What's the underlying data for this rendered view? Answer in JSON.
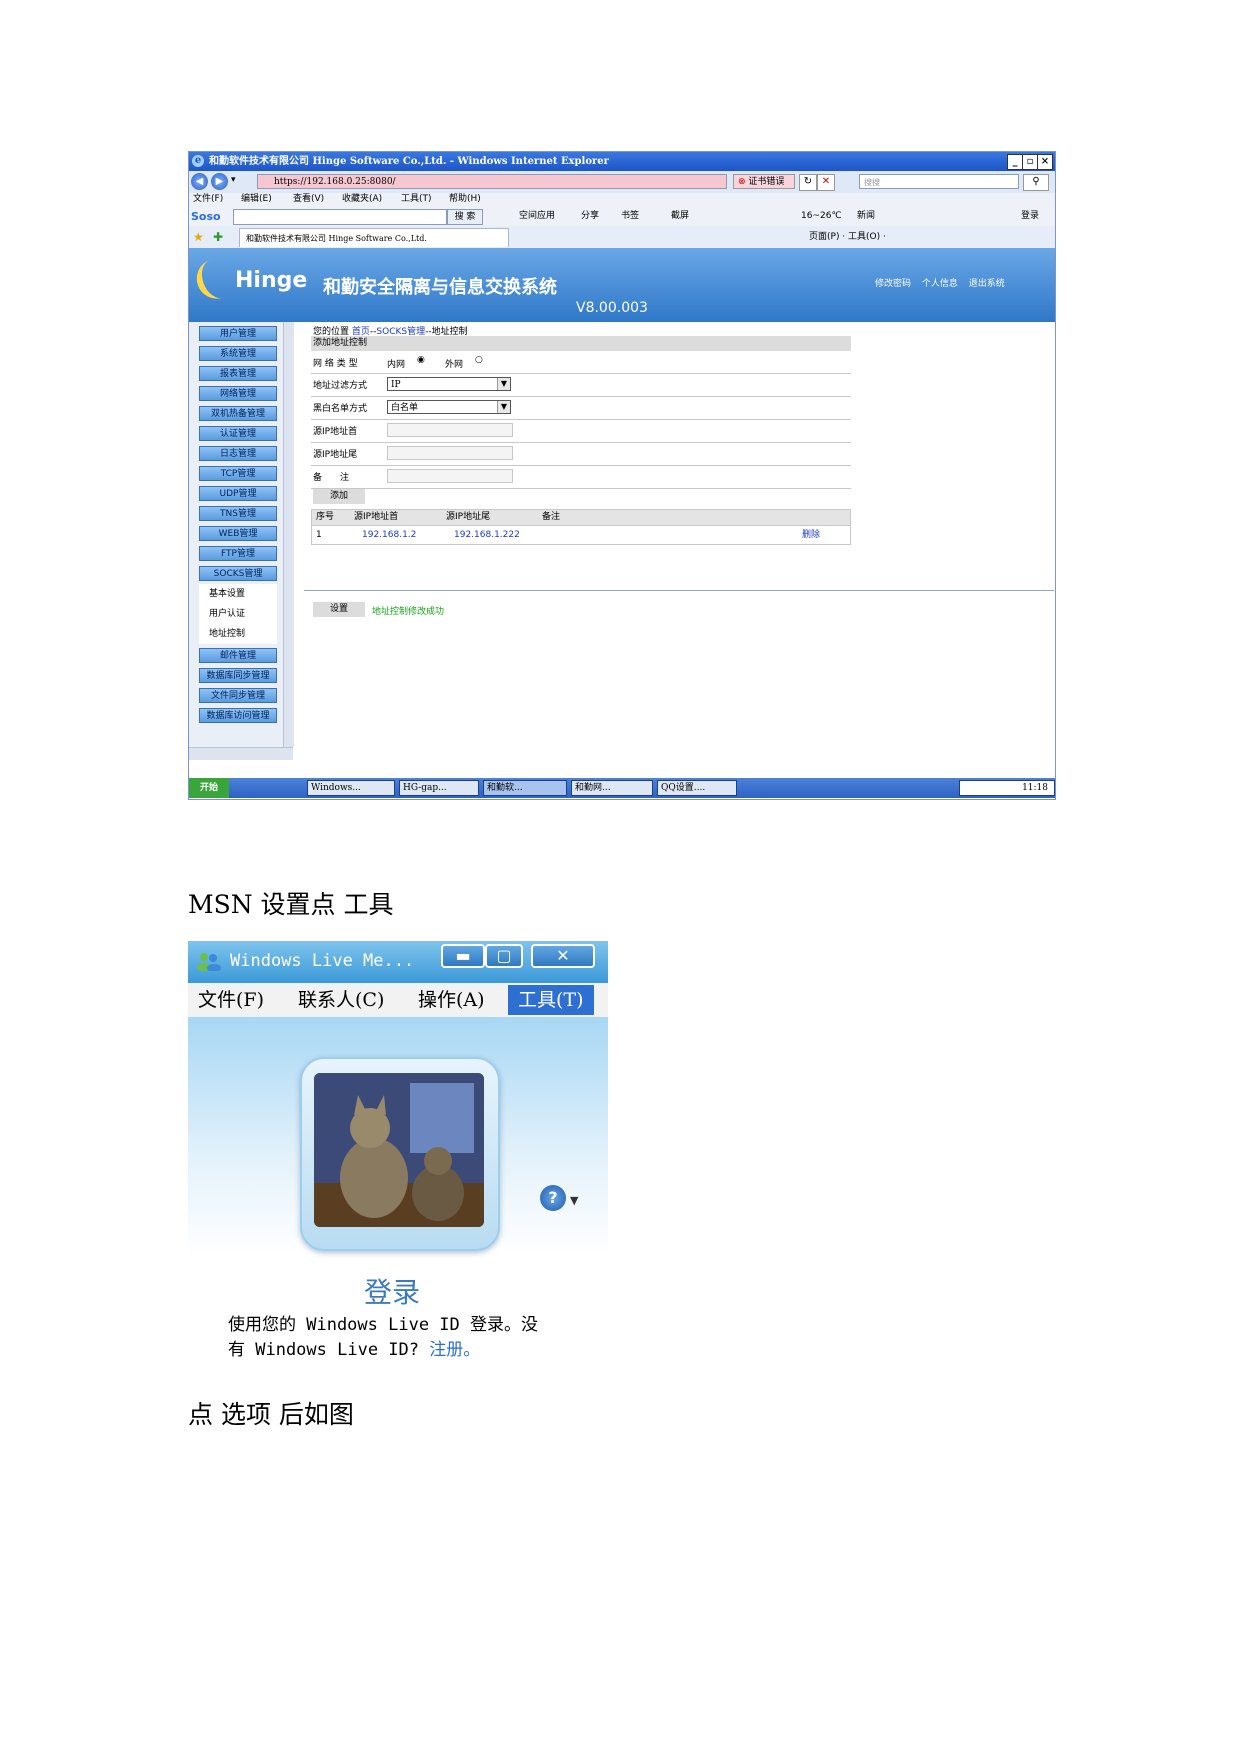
{
  "ie": {
    "title": "和勤软件技术有限公司 Hinge Software Co.,Ltd. - Windows Internet Explorer",
    "address": "https://192.168.0.25:8080/",
    "cert_error": "证书错误",
    "search_placeholder": "搜搜",
    "menu": [
      "文件(F)",
      "编辑(E)",
      "查看(V)",
      "收藏夹(A)",
      "工具(T)",
      "帮助(H)"
    ],
    "soso_logo": "Soso",
    "soso_search_label": "搜 索",
    "soso_items": [
      "空间应用",
      "分享",
      "书签",
      "截屏",
      "16~26℃",
      "新闻",
      "登录"
    ],
    "tab_title": "和勤软件技术有限公司 Hinge Software Co.,Ltd.",
    "tab_tools": "页面(P) · 工具(O) ·"
  },
  "app": {
    "brand": "Hinge",
    "system_name": "和勤安全隔离与信息交换系统",
    "version": "V8.00.003",
    "top_links": [
      "修改密码",
      "个人信息",
      "退出系统"
    ]
  },
  "sidebar": {
    "items": [
      "用户管理",
      "系统管理",
      "报表管理",
      "网络管理",
      "双机热备管理",
      "认证管理",
      "日志管理",
      "TCP管理",
      "UDP管理",
      "TNS管理",
      "WEB管理",
      "FTP管理",
      "SOCKS管理"
    ],
    "sub_items": [
      "基本设置",
      "用户认证",
      "地址控制"
    ],
    "items_after": [
      "邮件管理",
      "数据库同步管理",
      "文件同步管理",
      "数据库访问管理"
    ]
  },
  "content": {
    "breadcrumb_prefix": "您的位置",
    "breadcrumb_home": "首页",
    "breadcrumb_sep1": "--",
    "breadcrumb_socks": "SOCKS管理",
    "breadcrumb_sep2": "--",
    "breadcrumb_current": "地址控制",
    "form_header": "添加地址控制",
    "network_type_label": "网 络 类 型",
    "network_inner": "内网",
    "network_outer": "外网",
    "filter_label": "地址过滤方式",
    "filter_value": "IP",
    "list_label": "黑白名单方式",
    "list_value": "白名单",
    "src_start_label": "源IP地址首",
    "src_end_label": "源IP地址尾",
    "remark_label": "备　　注",
    "add_button": "添加",
    "table_headers": [
      "序号",
      "源IP地址首",
      "源IP地址尾",
      "备注"
    ],
    "table_rows": [
      {
        "no": "1",
        "start": "192.168.1.2",
        "end": "192.168.1.222",
        "remark": "",
        "action": "删除"
      }
    ],
    "set_button": "设置",
    "success_message": "地址控制修改成功"
  },
  "taskbar": {
    "start": "开始",
    "tasks": [
      "Windows...",
      "HG-gap...",
      "和勤软...",
      "和勤网...",
      "QQ设置...."
    ],
    "time": "11:18"
  },
  "para1": "MSN 设置点 工具",
  "msn": {
    "title": "Windows Live Me...",
    "menu": [
      "文件(F)",
      "联系人(C)",
      "操作(A)",
      "工具(T)"
    ],
    "sign_in": "登录",
    "desc_line1": "使用您的 Windows Live ID 登录。没",
    "desc_line2": "有 Windows Live ID?",
    "register": "注册。"
  },
  "para2": "点 选项 后如图"
}
